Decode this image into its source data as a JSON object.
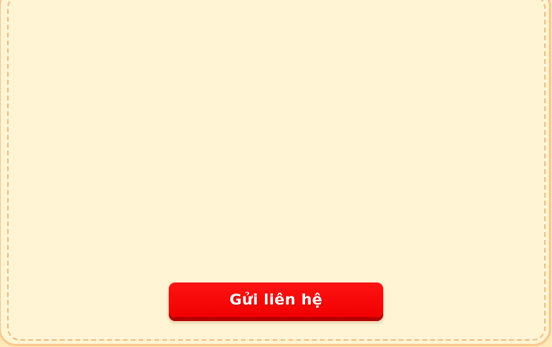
{
  "form": {
    "submit_label": "Gửi liên hệ"
  },
  "colors": {
    "panel_background": "#fff5d4",
    "panel_border": "#f8c98f",
    "dashed_border": "#f3bf86",
    "button_red": "#ff0000",
    "button_shadow": "#b50000",
    "button_text": "#ffffff"
  }
}
